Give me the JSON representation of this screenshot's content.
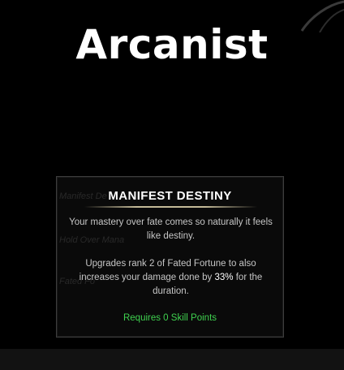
{
  "page": {
    "title": "Arcanist"
  },
  "tooltip": {
    "title": "MANIFEST DESTINY",
    "description": "Your mastery over fate comes so naturally it feels like destiny.",
    "upgrade_before": "Upgrades rank 2 of Fated Fortune to also increases your damage done by ",
    "upgrade_highlight": "33%",
    "upgrade_after": " for the duration.",
    "requirement": "Requires 0 Skill Points",
    "background_labels": [
      "Manifest De",
      "Hold Over Mana",
      "Fated Fo"
    ]
  },
  "colors": {
    "background": "#000000",
    "title": "#ffffff",
    "tooltip_text": "#c6c6c6",
    "highlight": "#ffffff",
    "requirement": "#3fd14f",
    "divider": "#cdc3a0"
  },
  "icons": {
    "corner_decoration": "swirl-decoration-icon"
  }
}
